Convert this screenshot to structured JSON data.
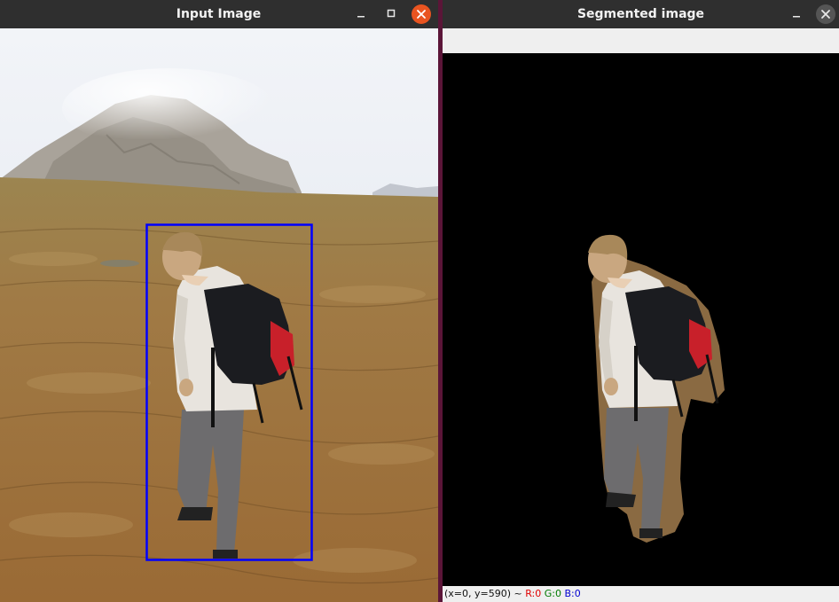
{
  "windows": {
    "input": {
      "title": "Input Image",
      "controls": {
        "minimize": "minimize-icon",
        "maximize": "maximize-icon",
        "close": "close-icon"
      }
    },
    "segmented": {
      "title": "Segmented image",
      "controls": {
        "minimize": "minimize-icon",
        "close": "close-icon"
      },
      "status": {
        "coords": "(x=0, y=590) ~",
        "r": "R:0",
        "g": "G:0",
        "b": "B:0"
      }
    }
  },
  "colors": {
    "titlebar": "#2f2f2f",
    "close_active": "#e95420",
    "bounding_box": "#0000ff",
    "desktop": "#5b1538"
  }
}
